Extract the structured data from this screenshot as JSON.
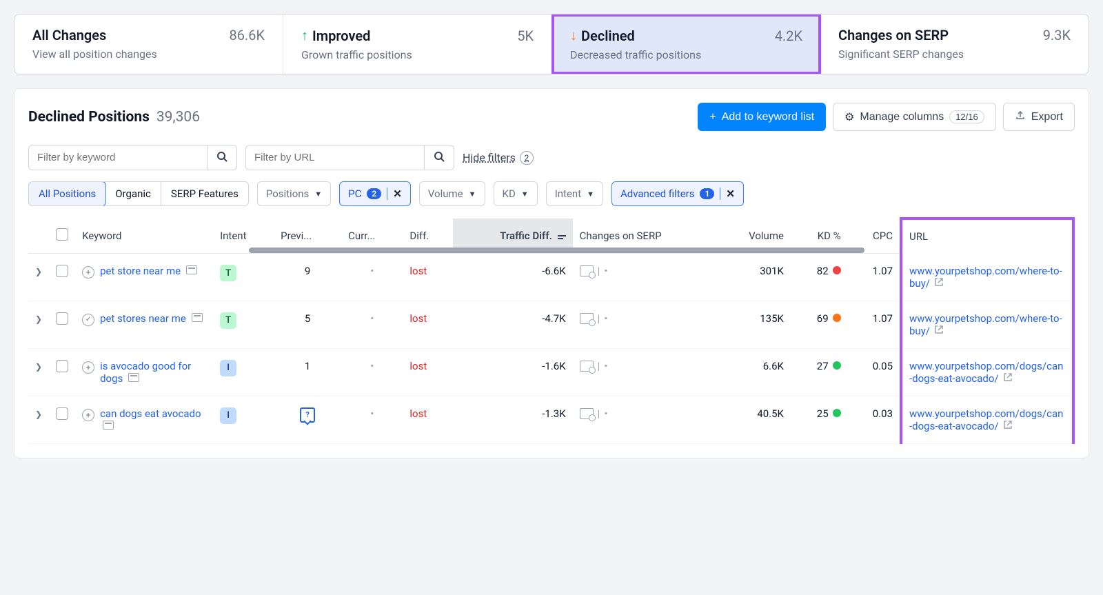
{
  "tabs": [
    {
      "title": "All Changes",
      "count": "86.6K",
      "desc": "View all position changes",
      "icon": null,
      "selected": false
    },
    {
      "title": "Improved",
      "count": "5K",
      "desc": "Grown traffic positions",
      "icon": "up",
      "selected": false
    },
    {
      "title": "Declined",
      "count": "4.2K",
      "desc": "Decreased traffic positions",
      "icon": "down",
      "selected": true
    },
    {
      "title": "Changes on SERP",
      "count": "9.3K",
      "desc": "Significant SERP changes",
      "icon": null,
      "selected": false
    }
  ],
  "panel": {
    "title": "Declined Positions",
    "count": "39,306",
    "actions": {
      "add_label": "Add to keyword list",
      "manage_label": "Manage columns",
      "manage_badge": "12/16",
      "export_label": "Export"
    }
  },
  "filters": {
    "keyword_placeholder": "Filter by keyword",
    "url_placeholder": "Filter by URL",
    "hide_label": "Hide filters",
    "hide_count": "2",
    "segments": [
      "All Positions",
      "Organic",
      "SERP Features"
    ],
    "seg_active": 0,
    "chips": {
      "positions": "Positions",
      "pc": "PC",
      "pc_count": "2",
      "volume": "Volume",
      "kd": "KD",
      "intent": "Intent",
      "advanced": "Advanced filters",
      "advanced_count": "1"
    }
  },
  "columns": [
    "Keyword",
    "Intent",
    "Previ...",
    "Curr...",
    "Diff.",
    "Traffic Diff.",
    "Changes on SERP",
    "Volume",
    "KD %",
    "CPC",
    "URL"
  ],
  "rows": [
    {
      "keyword": "pet store near me",
      "action": "plus",
      "intent": "T",
      "prev": "9",
      "prev_type": "num",
      "curr": "•",
      "diff": "lost",
      "traffic_diff": "-6.6K",
      "volume": "301K",
      "kd": "82",
      "kd_color": "red",
      "cpc": "1.07",
      "url": "www.yourpetshop.com/where-to-buy/"
    },
    {
      "keyword": "pet stores near me",
      "action": "check",
      "intent": "T",
      "prev": "5",
      "prev_type": "num",
      "curr": "•",
      "diff": "lost",
      "traffic_diff": "-4.7K",
      "volume": "135K",
      "kd": "69",
      "kd_color": "orange",
      "cpc": "1.07",
      "url": "www.yourpetshop.com/where-to-buy/"
    },
    {
      "keyword": "is avocado good for dogs",
      "action": "plus",
      "intent": "I",
      "prev": "1",
      "prev_type": "num",
      "curr": "•",
      "diff": "lost",
      "traffic_diff": "-1.6K",
      "volume": "6.6K",
      "kd": "27",
      "kd_color": "green",
      "cpc": "0.05",
      "url": "www.yourpetshop.com/dogs/can-dogs-eat-avocado/"
    },
    {
      "keyword": "can dogs eat avocado",
      "action": "plus",
      "intent": "I",
      "prev": "q",
      "prev_type": "icon",
      "curr": "•",
      "diff": "lost",
      "traffic_diff": "-1.3K",
      "volume": "40.5K",
      "kd": "25",
      "kd_color": "green",
      "cpc": "0.03",
      "url": "www.yourpetshop.com/dogs/can-dogs-eat-avocado/"
    }
  ]
}
